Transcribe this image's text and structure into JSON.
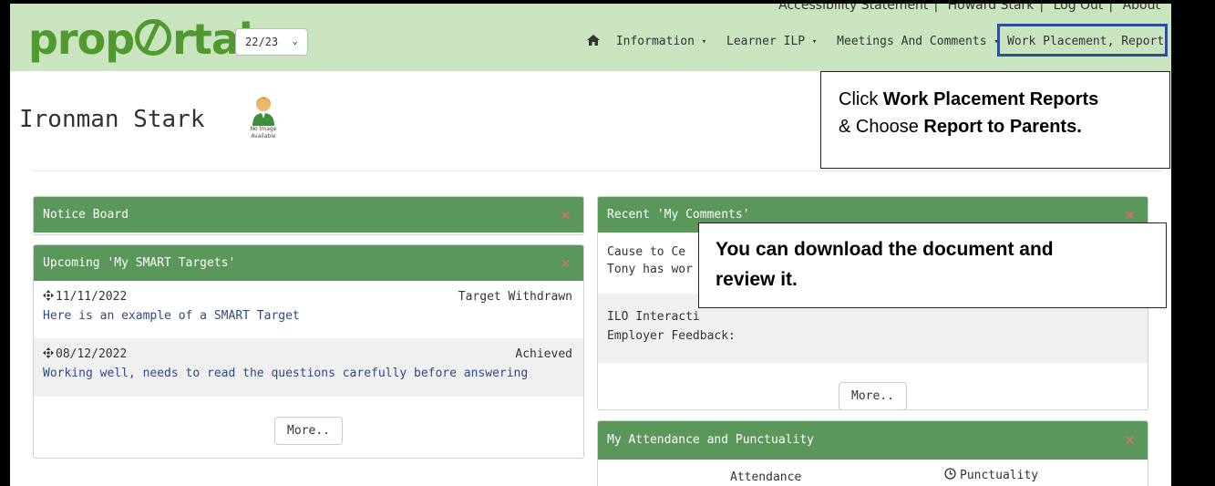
{
  "header": {
    "top_links": [
      "Accessibility Statement",
      "Howard Stark",
      "Log Out",
      "About"
    ],
    "logo_text": "propOrtal",
    "year_select": "22/23",
    "nav": [
      "Information",
      "Learner ILP",
      "Meetings And Comments"
    ],
    "highlighted_nav": "Work Placement, Reports"
  },
  "profile": {
    "name": "Ironman Stark",
    "no_image_text": "No Image Available"
  },
  "notice_board": {
    "title": "Notice Board"
  },
  "smart_targets": {
    "title": "Upcoming 'My SMART Targets'",
    "items": [
      {
        "date": "11/11/2022",
        "status": "Target Withdrawn",
        "text": "Here is an example of a SMART Target"
      },
      {
        "date": "08/12/2022",
        "status": "Achieved",
        "text": "Working well, needs to read the questions carefully before answering"
      }
    ],
    "more_label": "More.."
  },
  "recent_comments": {
    "title": "Recent 'My Comments'",
    "row1_line1": "Cause to Ce",
    "row1_line2": "Tony has wor",
    "row2_line1": "ILO Interacti",
    "row2_line2": "Employer Feedback:",
    "more_label": "More.."
  },
  "attendance": {
    "title": "My Attendance and Punctuality",
    "col1": "Attendance",
    "col2": "Punctuality"
  },
  "callouts": {
    "c1_pre": "Click ",
    "c1_bold1": "Work Placement Reports",
    "c1_mid": "& Choose ",
    "c1_bold2": "Report to Parents.",
    "c2": "You can download the document and review it."
  },
  "colors": {
    "header_bg": "#c9e4bf",
    "panel_head": "#5a975a",
    "logo": "#4f9a2f",
    "highlight_border": "#2d4e9a",
    "close": "#e36b6b"
  }
}
